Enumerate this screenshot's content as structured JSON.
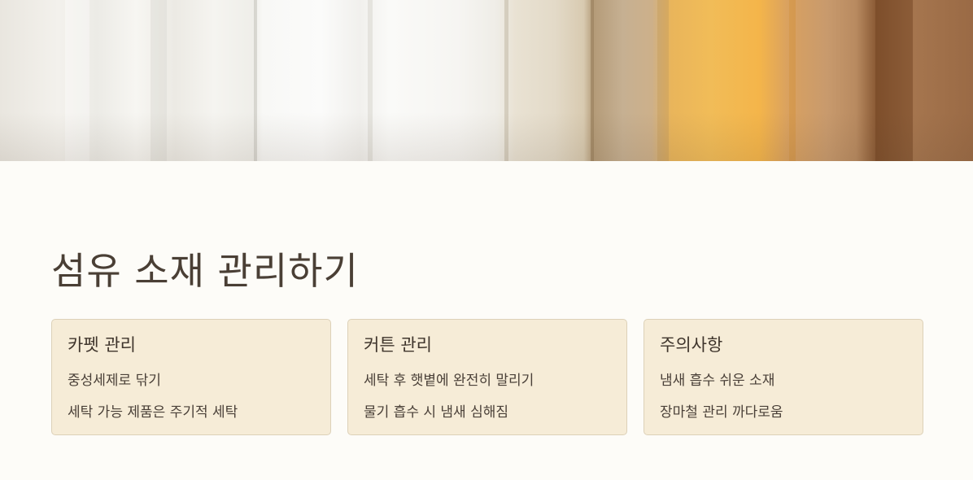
{
  "hero": {
    "image_name": "curtain-fabric-photo"
  },
  "page": {
    "title": "섬유 소재 관리하기"
  },
  "cards": [
    {
      "title": "카펫 관리",
      "lines": [
        "중성세제로 닦기",
        "세탁 가능 제품은 주기적 세탁"
      ]
    },
    {
      "title": "커튼 관리",
      "lines": [
        "세탁 후 햇볕에 완전히 말리기",
        "물기 흡수 시 냄새 심해짐"
      ]
    },
    {
      "title": "주의사항",
      "lines": [
        "냄새 흡수 쉬운 소재",
        "장마철 관리 까다로움"
      ]
    }
  ],
  "colors": {
    "background": "#fdfcf8",
    "card_background": "#f6ecd7",
    "card_border": "#ddd1b8",
    "title_text": "#4a3f35"
  }
}
